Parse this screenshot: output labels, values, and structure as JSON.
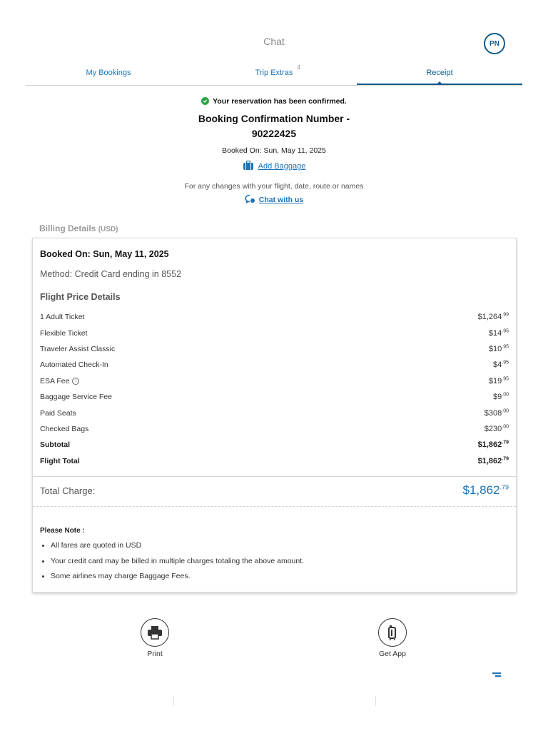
{
  "header": {
    "title": "Chat",
    "avatar_initials": "PN"
  },
  "tabs": [
    {
      "label": "My Bookings",
      "badge": ""
    },
    {
      "label": "Trip Extras",
      "badge": "4"
    },
    {
      "label": "Receipt",
      "badge": ""
    }
  ],
  "confirmation": {
    "message": "Your reservation has been confirmed.",
    "number_line1": "Booking Confirmation Number -",
    "number_line2": "90222425",
    "booked_on": "Booked On: Sun, May 11, 2025"
  },
  "add_baggage_label": "Add Baggage",
  "changes_text": "For any changes with your flight, date, route or names",
  "chat_with_us": "Chat with us",
  "billing": {
    "label": "Billing Details",
    "currency": "(USD)",
    "booked_on": "Booked On: Sun, May 11, 2025",
    "method": "Method: Credit Card ending in 8552",
    "section_title": "Flight Price Details",
    "items": [
      {
        "label": "1 Adult Ticket",
        "dollars": "$1,264",
        "cents": ".99"
      },
      {
        "label": "Flexible Ticket",
        "dollars": "$14",
        "cents": ".95"
      },
      {
        "label": "Traveler Assist Classic",
        "dollars": "$10",
        "cents": ".95"
      },
      {
        "label": "Automated Check-In",
        "dollars": "$4",
        "cents": ".95"
      },
      {
        "label": "ESA Fee",
        "dollars": "$19",
        "cents": ".95"
      },
      {
        "label": "Baggage Service Fee",
        "dollars": "$9",
        "cents": ".00"
      },
      {
        "label": "Paid Seats",
        "dollars": "$308",
        "cents": ".00"
      },
      {
        "label": "Checked Bags",
        "dollars": "$230",
        "cents": ".00"
      },
      {
        "label": "Subtotal",
        "dollars": "$1,862",
        "cents": ".79"
      },
      {
        "label": "Flight Total",
        "dollars": "$1,862",
        "cents": ".79"
      }
    ],
    "total_label": "Total Charge:",
    "total_dollars": "$1,862",
    "total_cents": ".79",
    "note_title": "Please Note :",
    "notes": [
      "All fares are quoted in USD",
      "Your credit card may be billed in multiple charges totaling the above amount.",
      "Some airlines may charge Baggage Fees."
    ]
  },
  "actions": {
    "print": "Print",
    "get_app": "Get App"
  },
  "colors": {
    "accent": "#1b73b8",
    "dark_accent": "#0e5b8f",
    "success": "#2aa745"
  }
}
